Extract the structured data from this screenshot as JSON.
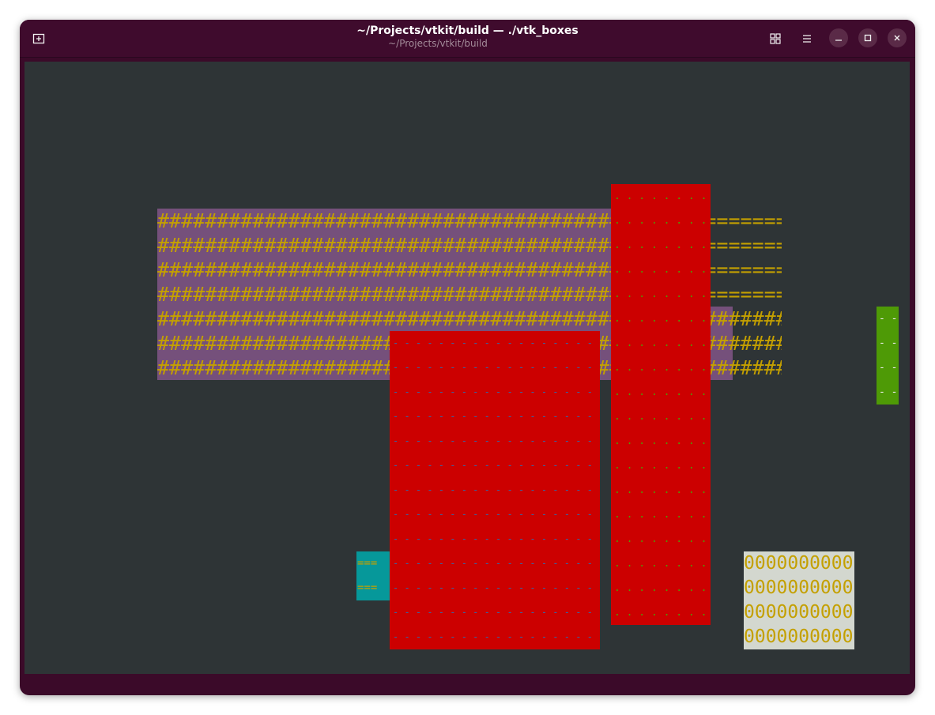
{
  "window": {
    "title": "~/Projects/vtkit/build — ./vtk_boxes",
    "subtitle": "~/Projects/vtkit/build"
  },
  "icons": {
    "new_tab": "new-tab-icon",
    "grid": "grid-view-icon",
    "menu": "hamburger-menu-icon",
    "minimize": "minimize-icon",
    "maximize": "maximize-icon",
    "close": "close-icon"
  },
  "colors": {
    "titlebar": "#3f0b2d",
    "terminal_bg": "#2e3436",
    "purple_box": "#75507b",
    "hash_fg": "#c4a000",
    "red_box": "#cc0000",
    "green_box": "#4e9a06",
    "teal_box": "#06989a",
    "light_box": "#d3d7cf"
  },
  "terminal": {
    "hash_rows": [
      "##############################################=======",
      "##############################################=======",
      "##############################################=======",
      "##############################################=======",
      "#####################################################",
      "#####################################################",
      "#####################################################"
    ],
    "red_tall_rows": [
      ". . . . . . . . .",
      ". . . . . . . . .",
      ". . . . . . . . .",
      ". . . . . . . . .",
      ". . . . . . . . .",
      ". . . . . . . . .",
      ". . . . . . . . .",
      ". . . . . . . . .",
      ". . . . . . . . .",
      ". . . . . . . . .",
      ". . . . . . . . .",
      ". . . . . . . . .",
      ". . . . . . . . .",
      ". . . . . . . . .",
      ". . . . . . . . .",
      ". . . . . . . . .",
      ". . . . . . . . .",
      ". . . . . . . . ."
    ],
    "red_big_rows": [
      "- - - - - - - - - - - - - - - - - - -",
      "- - - - - - - - - - - - - - - - - - -",
      "- - - - - - - - - - - - - - - - - - -",
      "- - - - - - - - - - - - - - - - - - -",
      "- - - - - - - - - - - - - - - - - - -",
      "- - - - - - - - - - - - - - - - - - -",
      "- - - - - - - - - - - - - - - - - - -",
      "- - - - - - - - - - - - - - - - - - -",
      "- - - - - - - - - - - - - - - - - - -",
      "- - - - - - - - - - - - - - - - - - -",
      "- - - - - - - - - - - - - - - - - - -",
      "- - - - - - - - - - - - - - - - - - -",
      "- - - - - - - - - - - - - - - - - - -"
    ],
    "green_rows": [
      "- -",
      "- -",
      "- -",
      "- -"
    ],
    "teal_rows": [
      "===",
      "==="
    ],
    "zero_rows": [
      "0000000000",
      "0000000000",
      "0000000000",
      "0000000000"
    ]
  }
}
